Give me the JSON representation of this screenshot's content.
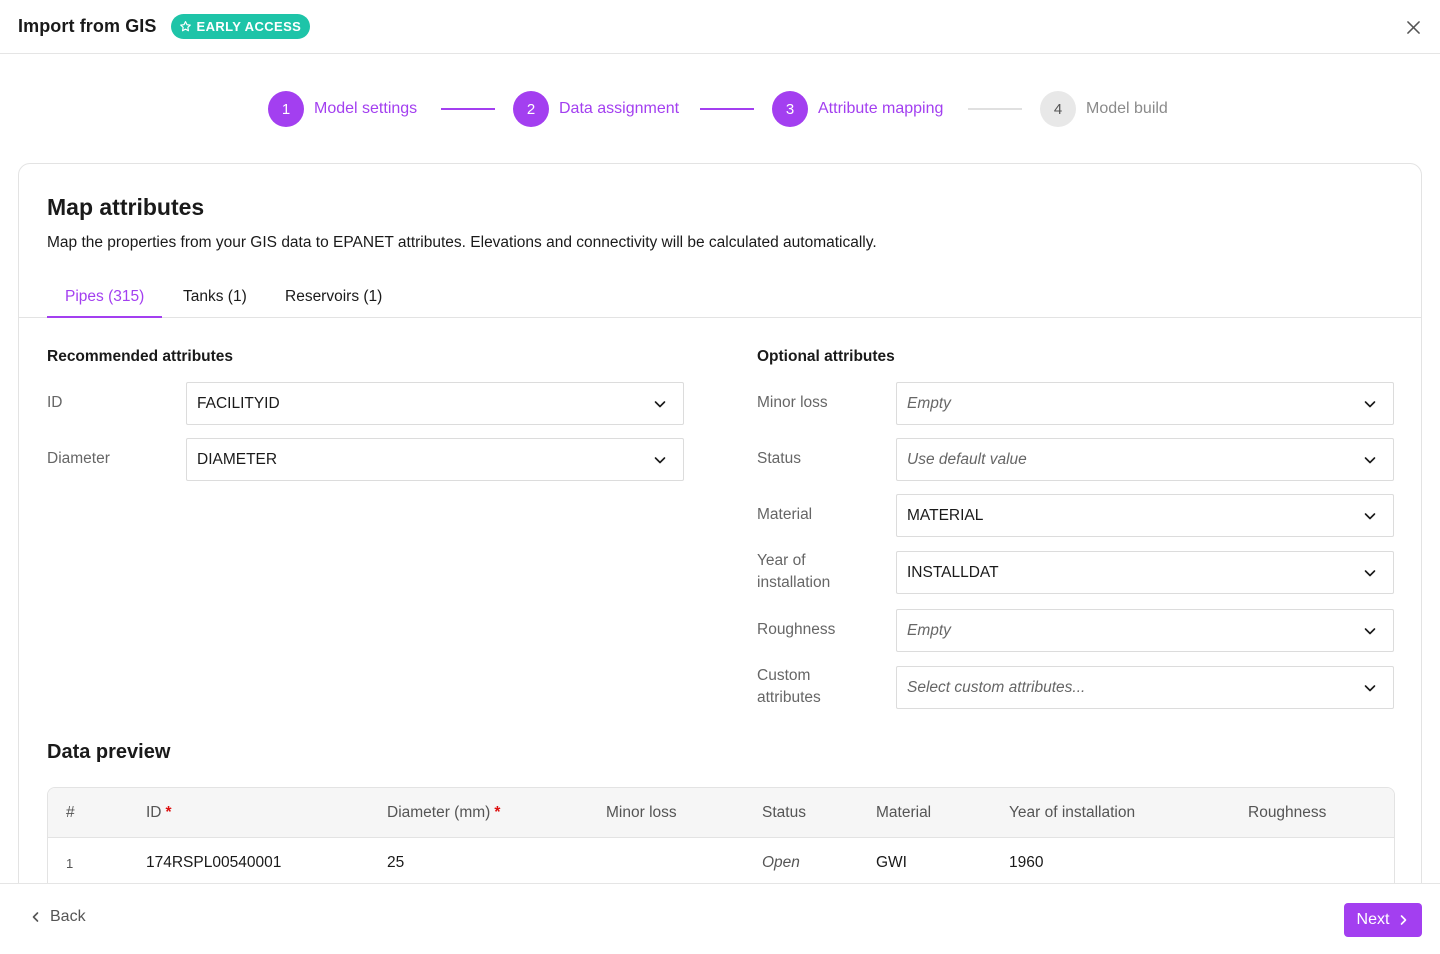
{
  "header": {
    "title": "Import from GIS",
    "badge": "EARLY ACCESS"
  },
  "stepper": [
    {
      "number": "1",
      "label": "Model settings",
      "state": "active"
    },
    {
      "number": "2",
      "label": "Data assignment",
      "state": "active"
    },
    {
      "number": "3",
      "label": "Attribute mapping",
      "state": "active"
    },
    {
      "number": "4",
      "label": "Model build",
      "state": "inactive"
    }
  ],
  "card": {
    "title": "Map attributes",
    "description": "Map the properties from your GIS data to EPANET attributes. Elevations and connectivity will be calculated automatically."
  },
  "tabs": [
    {
      "label": "Pipes (315)",
      "active": true
    },
    {
      "label": "Tanks (1)",
      "active": false
    },
    {
      "label": "Reservoirs (1)",
      "active": false
    }
  ],
  "recommended": {
    "title": "Recommended attributes",
    "fields": [
      {
        "label": "ID",
        "value": "FACILITYID"
      },
      {
        "label": "Diameter",
        "value": "DIAMETER"
      }
    ]
  },
  "optional": {
    "title": "Optional attributes",
    "fields": [
      {
        "label": "Minor loss",
        "value": "Empty"
      },
      {
        "label": "Status",
        "value": "Use default value"
      },
      {
        "label": "Material",
        "value": "MATERIAL"
      },
      {
        "label": "Year of installation",
        "value": "INSTALLDAT"
      },
      {
        "label": "Roughness",
        "value": "Empty"
      },
      {
        "label": "Custom attributes",
        "value": "Select custom attributes..."
      }
    ]
  },
  "preview": {
    "title": "Data preview",
    "columns": [
      "#",
      "ID",
      "Diameter (mm)",
      "Minor loss",
      "Status",
      "Material",
      "Year of installation",
      "Roughness"
    ],
    "required_marker": "*",
    "rows": [
      [
        "1",
        "174RSPL00540001",
        "25",
        "",
        "Open",
        "GWI",
        "1960",
        ""
      ]
    ]
  },
  "footer": {
    "back_label": "Back",
    "next_label": "Next"
  },
  "colors": {
    "accent": "#a33ff0",
    "badge": "#1ec4a8",
    "required": "#dd1111"
  }
}
